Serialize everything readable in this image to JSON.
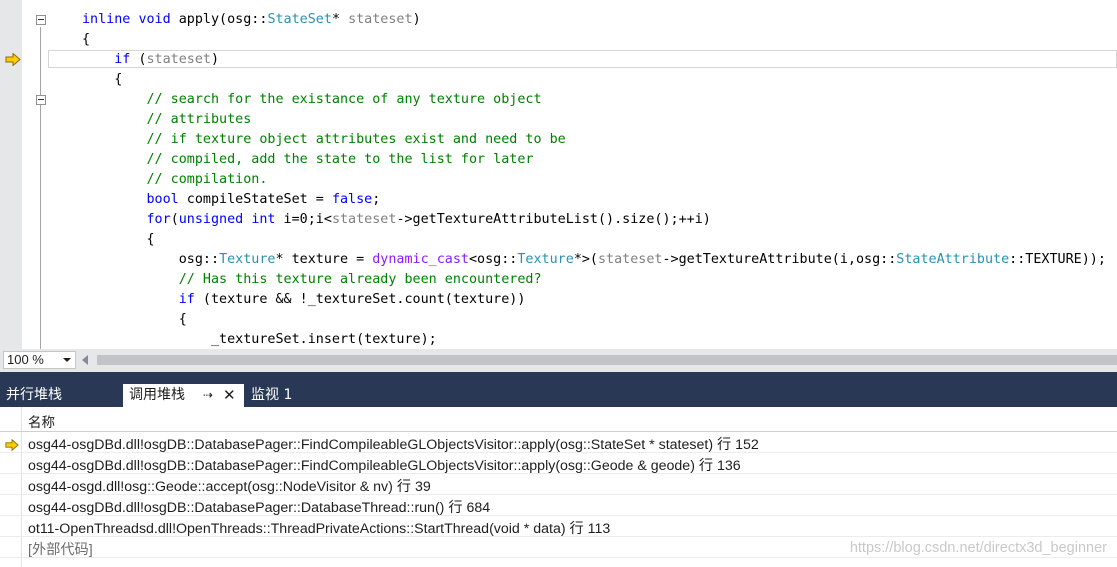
{
  "editor": {
    "code_lines": [
      [
        {
          "t": "inline",
          "c": "kw"
        },
        {
          "t": " "
        },
        {
          "t": "void",
          "c": "kw"
        },
        {
          "t": " apply(osg::"
        },
        {
          "t": "StateSet",
          "c": "ty"
        },
        {
          "t": "* "
        },
        {
          "t": "stateset",
          "c": "gr"
        },
        {
          "t": ")"
        }
      ],
      [
        {
          "t": "{"
        }
      ],
      [
        {
          "t": "    "
        },
        {
          "t": "if",
          "c": "kw"
        },
        {
          "t": " ("
        },
        {
          "t": "stateset",
          "c": "gr"
        },
        {
          "t": ")"
        }
      ],
      [
        {
          "t": "    {"
        }
      ],
      [
        {
          "t": "        "
        },
        {
          "t": "// search for the existance of any texture object",
          "c": "cm"
        }
      ],
      [
        {
          "t": "        "
        },
        {
          "t": "// attributes",
          "c": "cm"
        }
      ],
      [
        {
          "t": "        "
        },
        {
          "t": "// if texture object attributes exist and need to be",
          "c": "cm"
        }
      ],
      [
        {
          "t": "        "
        },
        {
          "t": "// compiled, add the state to the list for later",
          "c": "cm"
        }
      ],
      [
        {
          "t": "        "
        },
        {
          "t": "// compilation.",
          "c": "cm"
        }
      ],
      [
        {
          "t": "        "
        },
        {
          "t": "bool",
          "c": "kw"
        },
        {
          "t": " compileStateSet = "
        },
        {
          "t": "false",
          "c": "kw"
        },
        {
          "t": ";"
        }
      ],
      [
        {
          "t": "        "
        },
        {
          "t": "for",
          "c": "kw"
        },
        {
          "t": "("
        },
        {
          "t": "unsigned",
          "c": "kw"
        },
        {
          "t": " "
        },
        {
          "t": "int",
          "c": "kw"
        },
        {
          "t": " i=0;i<"
        },
        {
          "t": "stateset",
          "c": "gr"
        },
        {
          "t": "->getTextureAttributeList().size();++i)"
        }
      ],
      [
        {
          "t": "        {"
        }
      ],
      [
        {
          "t": "            osg::"
        },
        {
          "t": "Texture",
          "c": "ty"
        },
        {
          "t": "* texture = "
        },
        {
          "t": "dynamic_cast",
          "c": "mg"
        },
        {
          "t": "<osg::"
        },
        {
          "t": "Texture",
          "c": "ty"
        },
        {
          "t": "*>("
        },
        {
          "t": "stateset",
          "c": "gr"
        },
        {
          "t": "->getTextureAttribute(i,osg::"
        },
        {
          "t": "StateAttribute",
          "c": "ty"
        },
        {
          "t": "::TEXTURE));"
        }
      ],
      [
        {
          "t": "            "
        },
        {
          "t": "// Has this texture already been encountered?",
          "c": "cm"
        }
      ],
      [
        {
          "t": "            "
        },
        {
          "t": "if",
          "c": "kw"
        },
        {
          "t": " (texture && !_textureSet.count(texture))"
        }
      ],
      [
        {
          "t": "            {"
        }
      ],
      [
        {
          "t": "                _textureSet.insert(texture);"
        }
      ]
    ],
    "icons": {
      "current_statement": "yellow-arrow-icon",
      "fold": "collapse-minus-icon"
    }
  },
  "zoom": {
    "value": "100 %"
  },
  "tabs": [
    {
      "label": "并行堆栈"
    },
    {
      "label": "调用堆栈"
    },
    {
      "label": "监视 1"
    }
  ],
  "callstack": {
    "column_header": "名称",
    "rows": [
      {
        "text": "osg44-osgDBd.dll!osgDB::DatabasePager::FindCompileableGLObjectsVisitor::apply(osg::StateSet * stateset) 行 152",
        "current": true
      },
      {
        "text": "osg44-osgDBd.dll!osgDB::DatabasePager::FindCompileableGLObjectsVisitor::apply(osg::Geode & geode) 行 136",
        "current": false
      },
      {
        "text": "osg44-osgd.dll!osg::Geode::accept(osg::NodeVisitor & nv) 行 39",
        "current": false
      },
      {
        "text": "osg44-osgDBd.dll!osgDB::DatabasePager::DatabaseThread::run() 行 684",
        "current": false
      },
      {
        "text": "ot11-OpenThreadsd.dll!OpenThreads::ThreadPrivateActions::StartThread(void * data) 行 113",
        "current": false
      },
      {
        "text": "[外部代码]",
        "current": false,
        "external": true
      }
    ]
  },
  "watermark": "https://blog.csdn.net/directx3d_beginner",
  "colors": {
    "tab_bar": "#293955",
    "keyword": "#0000ff",
    "type": "#2b91af",
    "comment": "#008000",
    "arrow": "#ffcc00"
  }
}
